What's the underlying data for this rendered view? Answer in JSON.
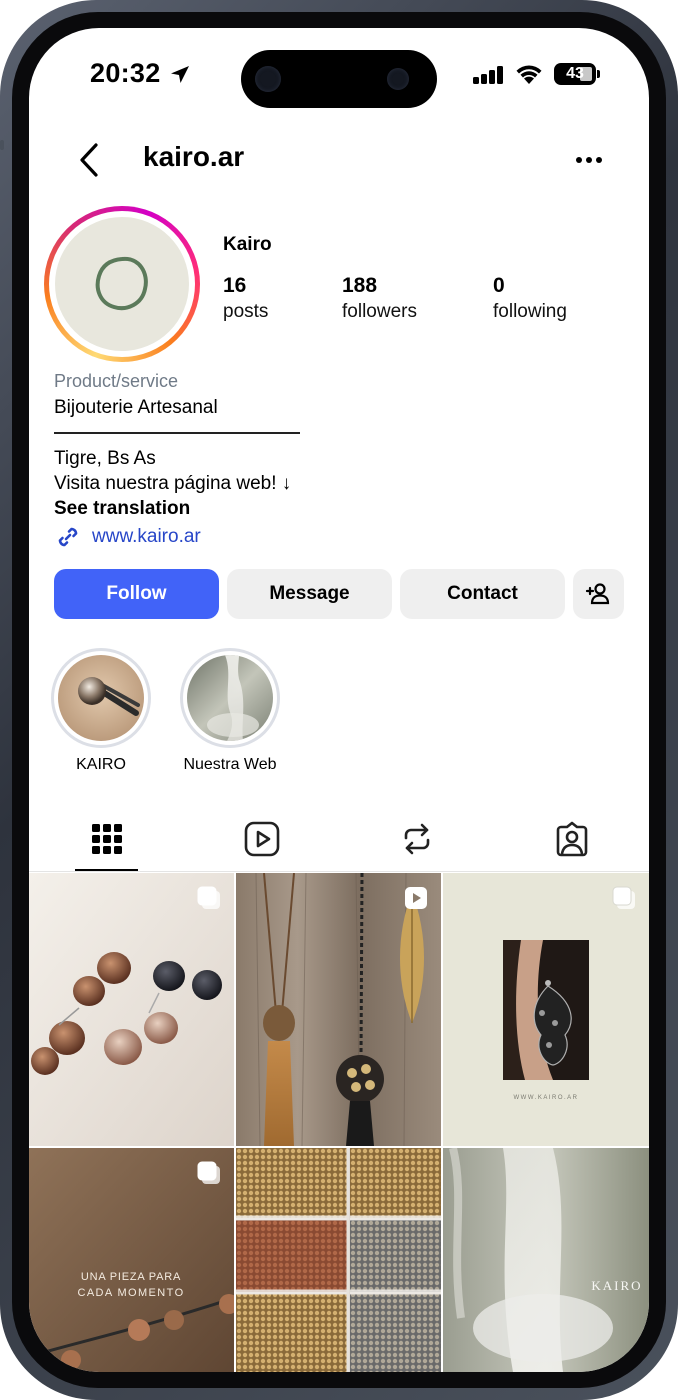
{
  "status_bar": {
    "time": "20:32",
    "battery": "43"
  },
  "header": {
    "username": "kairo.ar"
  },
  "profile": {
    "display_name": "Kairo",
    "stats": [
      {
        "num": "16",
        "label": "posts"
      },
      {
        "num": "188",
        "label": "followers"
      },
      {
        "num": "0",
        "label": "following"
      }
    ],
    "category": "Product/service",
    "bio_line1": "Bijouterie Artesanal",
    "bio_line2": "Tigre, Bs As",
    "bio_line3": "Visita nuestra página web! ↓",
    "see_translation": "See translation",
    "link": "www.kairo.ar"
  },
  "actions": {
    "follow": "Follow",
    "message": "Message",
    "contact": "Contact",
    "add_user_icon": "person-add-icon"
  },
  "highlights": [
    {
      "label": "KAIRO"
    },
    {
      "label": "Nuestra Web"
    }
  ],
  "tabs": [
    {
      "icon": "grid-icon",
      "active": true
    },
    {
      "icon": "reels-icon",
      "active": false
    },
    {
      "icon": "reposts-icon",
      "active": false
    },
    {
      "icon": "tagged-icon",
      "active": false
    }
  ],
  "posts": {
    "badges": [
      "carousel",
      "reel",
      "carousel",
      "carousel",
      "",
      ""
    ],
    "post4_text_line1": "UNA PIEZA PARA",
    "post4_text_line2": "CADA MOMENTO",
    "post3_caption": "WWW.KAIRO.AR",
    "post6_brand": "KAIRO"
  },
  "colors": {
    "follow_button": "#4163f8",
    "secondary_button": "#efefef",
    "link": "#2746c8",
    "category_text": "#6f7a87"
  }
}
